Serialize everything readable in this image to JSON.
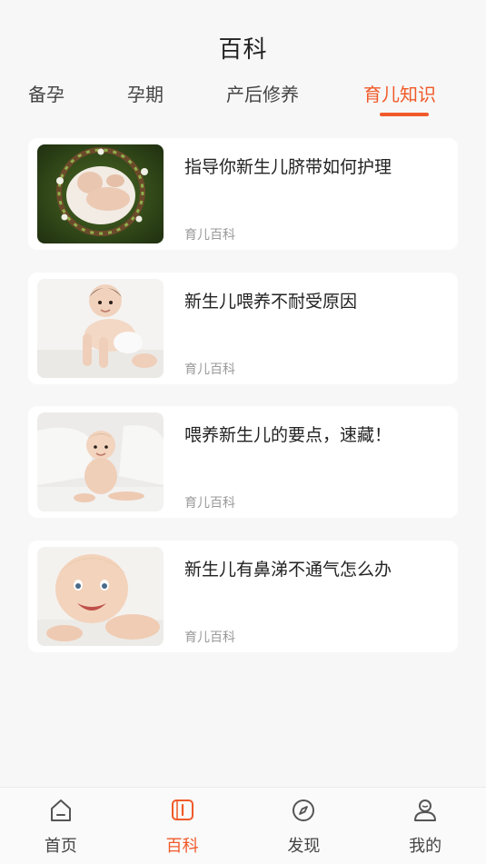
{
  "header": {
    "title": "百科"
  },
  "tabs": [
    {
      "label": "备孕",
      "active": false
    },
    {
      "label": "孕期",
      "active": false
    },
    {
      "label": "产后修养",
      "active": false
    },
    {
      "label": "育儿知识",
      "active": true
    }
  ],
  "articles": [
    {
      "title": "指导你新生儿脐带如何护理",
      "source": "育儿百科",
      "image": "newborn-in-flower-wreath"
    },
    {
      "title": "新生儿喂养不耐受原因",
      "source": "育儿百科",
      "image": "crawling-baby"
    },
    {
      "title": "喂养新生儿的要点，速藏！",
      "source": "育儿百科",
      "image": "sitting-baby"
    },
    {
      "title": "新生儿有鼻涕不通气怎么办",
      "source": "育儿百科",
      "image": "smiling-baby-closeup"
    }
  ],
  "bottom_nav": [
    {
      "label": "首页",
      "icon": "home-icon",
      "active": false
    },
    {
      "label": "百科",
      "icon": "book-icon",
      "active": true
    },
    {
      "label": "发现",
      "icon": "compass-icon",
      "active": false
    },
    {
      "label": "我的",
      "icon": "profile-icon",
      "active": false
    }
  ],
  "colors": {
    "accent": "#f05a2a",
    "background": "#f7f7f7",
    "card": "#ffffff",
    "muted": "#999999"
  }
}
